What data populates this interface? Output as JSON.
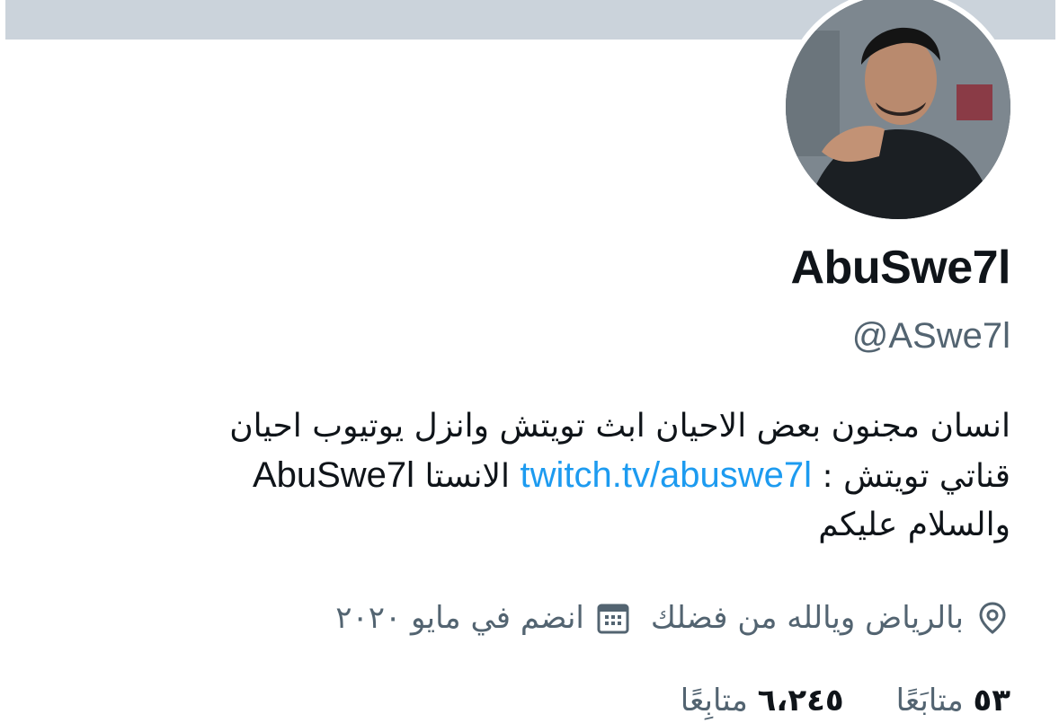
{
  "profile": {
    "display_name": "AbuSwe7l",
    "handle": "@ASwe7l",
    "bio": {
      "line1": "انسان مجنون بعض الاحيان ابث تويتش وانزل يوتيوب احيان",
      "line2_prefix": "قناتي تويتش :",
      "line2_link": "twitch.tv/abuswe7l",
      "line2_middle": "الانستا",
      "line2_suffix": "AbuSwe7l",
      "line3": "والسلام عليكم"
    },
    "location": "بالرياض ويالله من فضلك",
    "joined": "انضم في مايو ٢٠٢٠",
    "following_count": "٥٣",
    "following_label": "متابَعًا",
    "followers_count": "٦،٢٤٥",
    "followers_label": "متابِعًا"
  },
  "icons": {
    "location": "location-pin-icon",
    "calendar": "calendar-icon"
  },
  "colors": {
    "link": "#1d9bf0",
    "secondary_text": "#536471",
    "banner": "#cbd3db"
  }
}
